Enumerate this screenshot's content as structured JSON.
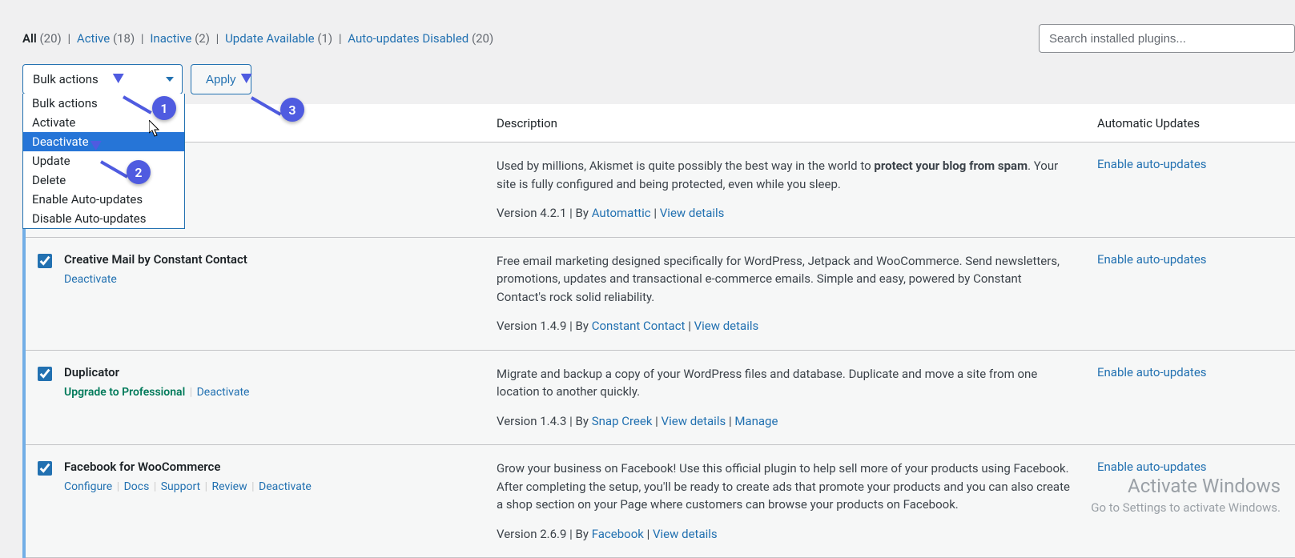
{
  "filters": {
    "all_label": "All",
    "all_count": "(20)",
    "active_label": "Active",
    "active_count": "(18)",
    "inactive_label": "Inactive",
    "inactive_count": "(2)",
    "update_label": "Update Available",
    "update_count": "(1)",
    "auto_label": "Auto-updates Disabled",
    "auto_count": "(20)"
  },
  "search": {
    "placeholder": "Search installed plugins..."
  },
  "bulk": {
    "selected": "Bulk actions",
    "options": [
      "Bulk actions",
      "Activate",
      "Deactivate",
      "Update",
      "Delete",
      "Enable Auto-updates",
      "Disable Auto-updates"
    ],
    "highlighted_index": 2,
    "apply_label": "Apply"
  },
  "columns": {
    "description": "Description",
    "auto": "Automatic Updates"
  },
  "plugins": [
    {
      "name": "Creative Mail by Constant Contact",
      "actions": [
        {
          "label": "Deactivate"
        }
      ],
      "description": "Free email marketing designed specifically for WordPress, Jetpack and WooCommerce. Send newsletters, promotions, updates and transactional e-commerce emails. Simple and easy, powered by Constant Contact's rock solid reliability.",
      "version": "Version 1.4.9",
      "by": "By",
      "author": "Constant Contact",
      "extra_links": [
        "View details"
      ],
      "auto_link": "Enable auto-updates"
    },
    {
      "name": "Duplicator",
      "actions": [
        {
          "label": "Upgrade to Professional",
          "class": "upgrade"
        },
        {
          "label": "Deactivate"
        }
      ],
      "description": "Migrate and backup a copy of your WordPress files and database. Duplicate and move a site from one location to another quickly.",
      "version": "Version 1.4.3",
      "by": "By",
      "author": "Snap Creek",
      "extra_links": [
        "View details",
        "Manage"
      ],
      "auto_link": "Enable auto-updates"
    },
    {
      "name": "Facebook for WooCommerce",
      "actions": [
        {
          "label": "Configure"
        },
        {
          "label": "Docs"
        },
        {
          "label": "Support"
        },
        {
          "label": "Review"
        },
        {
          "label": "Deactivate"
        }
      ],
      "description": "Grow your business on Facebook! Use this official plugin to help sell more of your products using Facebook. After completing the setup, you'll be ready to create ads that promote your products and you can also create a shop section on your Page where customers can browse your products on Facebook.",
      "version": "Version 2.6.9",
      "by": "By",
      "author": "Facebook",
      "extra_links": [
        "View details"
      ],
      "auto_link": "Enable auto-updates"
    }
  ],
  "hidden_first": {
    "desc_prefix": "Used by millions, Akismet is quite possibly the best way in the world to ",
    "desc_strong": "protect your blog from spam",
    "desc_suffix": ". Your site is fully configured and being protected, even while you sleep.",
    "version": "Version 4.2.1",
    "by": "By",
    "author": "Automattic",
    "extra_link": "View details",
    "auto_link": "Enable auto-updates"
  },
  "badges": {
    "one": "1",
    "two": "2",
    "three": "3"
  },
  "watermark": {
    "title": "Activate Windows",
    "sub": "Go to Settings to activate Windows."
  }
}
